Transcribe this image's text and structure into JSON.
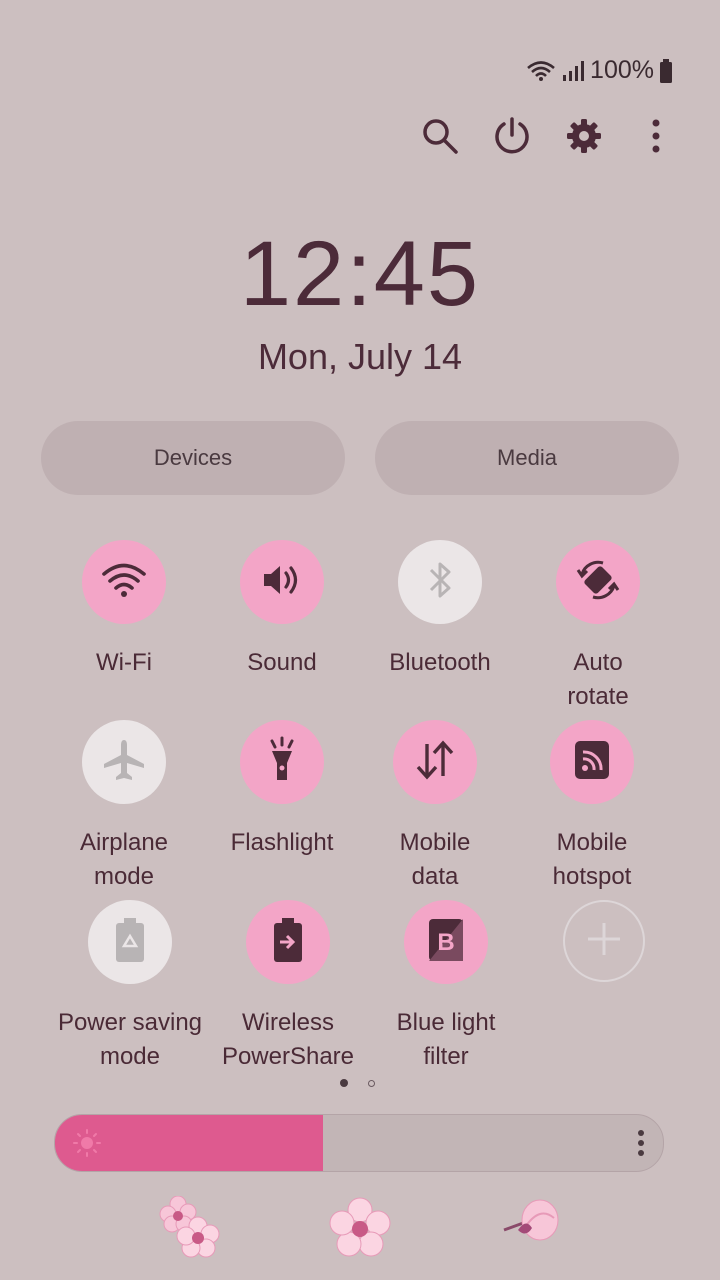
{
  "status": {
    "battery_text": "100%"
  },
  "clock": {
    "time": "12:45",
    "date": "Mon, July 14"
  },
  "panel_buttons": {
    "devices": "Devices",
    "media": "Media"
  },
  "tiles": [
    {
      "label": "Wi-Fi",
      "icon": "wifi-icon",
      "state": "on"
    },
    {
      "label": "Sound",
      "icon": "sound-icon",
      "state": "on"
    },
    {
      "label": "Bluetooth",
      "icon": "bluetooth-icon",
      "state": "off"
    },
    {
      "label": "Auto\nrotate",
      "icon": "auto-rotate-icon",
      "state": "on"
    },
    {
      "label": "Airplane\nmode",
      "icon": "airplane-icon",
      "state": "off"
    },
    {
      "label": "Flashlight",
      "icon": "flashlight-icon",
      "state": "on"
    },
    {
      "label": "Mobile\ndata",
      "icon": "mobile-data-icon",
      "state": "on"
    },
    {
      "label": "Mobile\nhotspot",
      "icon": "hotspot-icon",
      "state": "on"
    },
    {
      "label": "Power saving\nmode",
      "icon": "power-saving-icon",
      "state": "off"
    },
    {
      "label": "Wireless\nPowerShare",
      "icon": "wireless-powershare-icon",
      "state": "on"
    },
    {
      "label": "Blue light\nfilter",
      "icon": "blue-light-filter-icon",
      "state": "on"
    }
  ],
  "brightness": {
    "level": 0.44
  },
  "page_indicator": {
    "current": 1,
    "total": 2
  },
  "colors": {
    "accent": "#f3a5c7",
    "slider_fill": "#de5a8f",
    "background": "#ccbfc0"
  }
}
